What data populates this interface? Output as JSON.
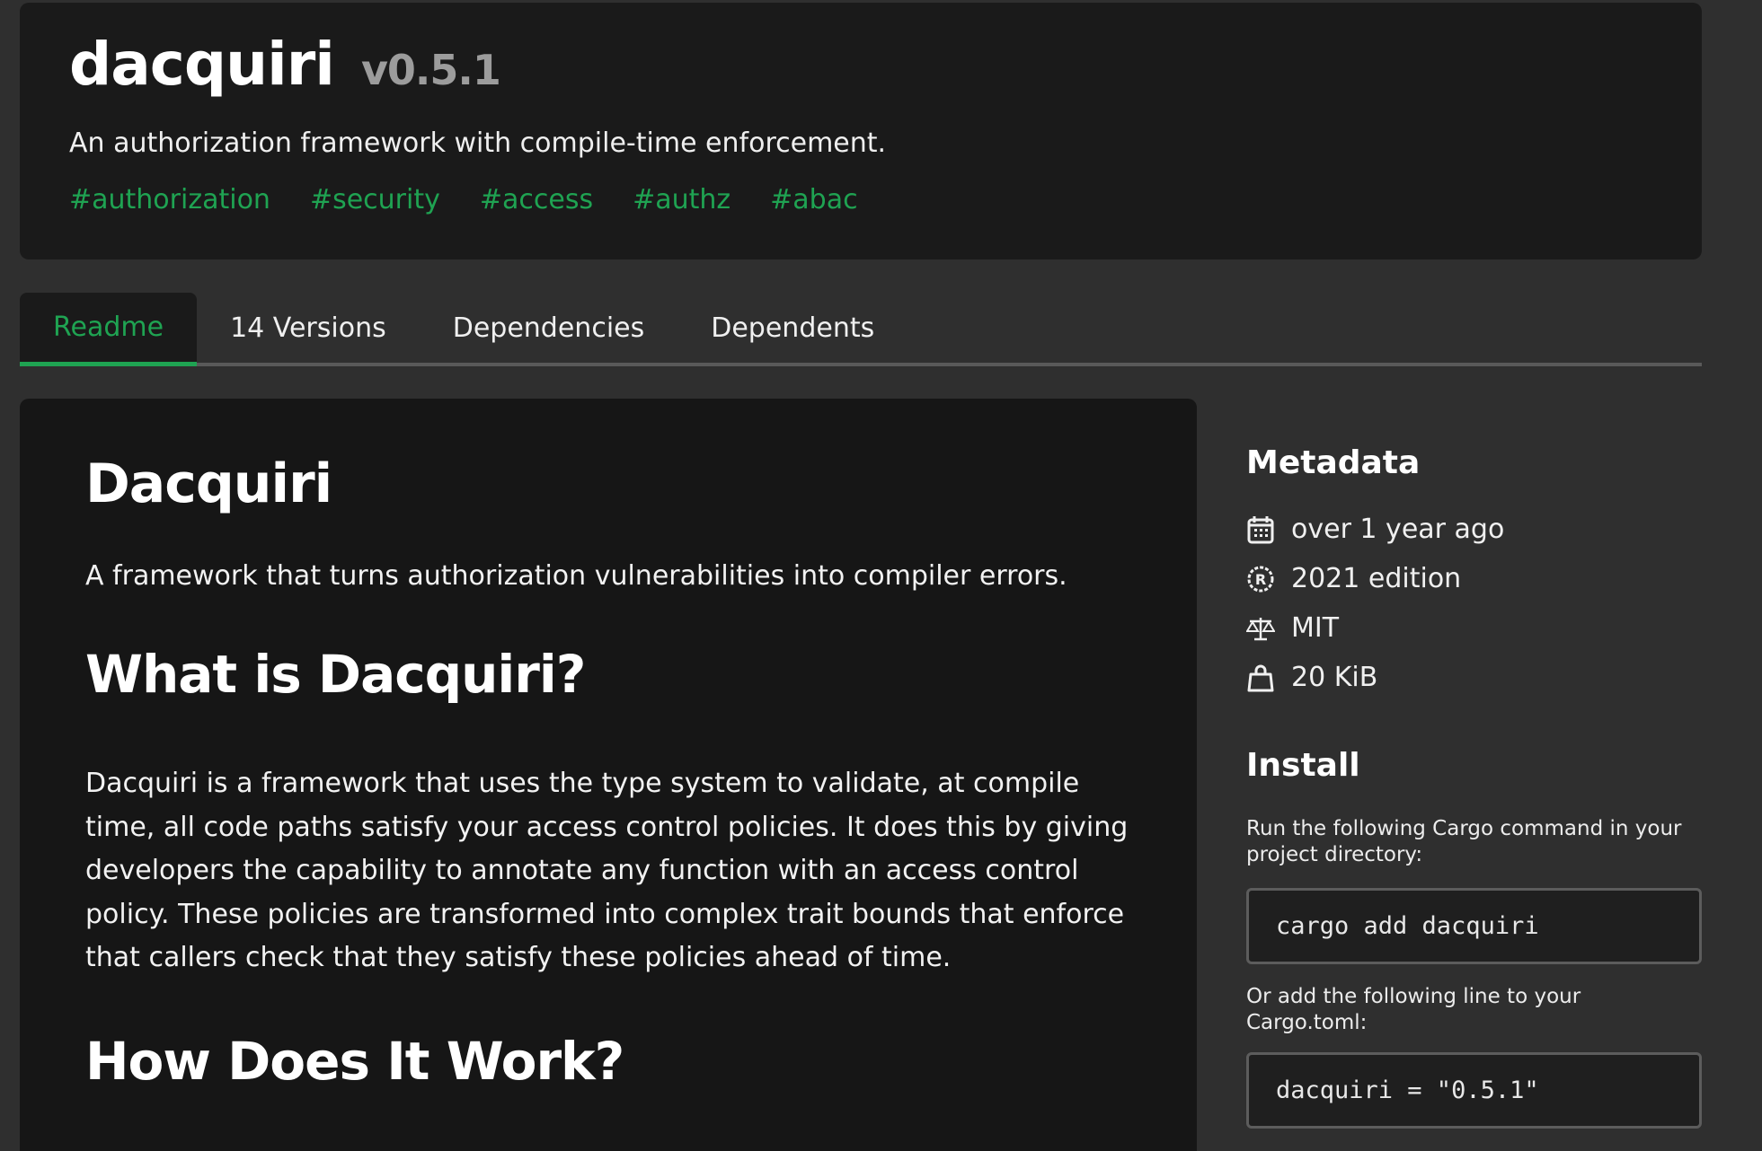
{
  "header": {
    "name": "dacquiri",
    "version": "v0.5.1",
    "description": "An authorization framework with compile-time enforcement.",
    "keywords": [
      "#authorization",
      "#security",
      "#access",
      "#authz",
      "#abac"
    ]
  },
  "tabs": [
    {
      "label": "Readme",
      "active": true
    },
    {
      "label": "14 Versions",
      "active": false
    },
    {
      "label": "Dependencies",
      "active": false
    },
    {
      "label": "Dependents",
      "active": false
    }
  ],
  "readme": {
    "title": "Dacquiri",
    "lede": "A framework that turns authorization vulnerabilities into compiler errors.",
    "section1_title": "What is Dacquiri?",
    "section1_body": "Dacquiri is a framework that uses the type system to validate, at compile time, all code paths satisfy your access control policies. It does this by giving developers the capability to annotate any function with an access control policy. These policies are transformed into complex trait bounds that enforce that callers check that they satisfy these policies ahead of time.",
    "section2_title": "How Does It Work?"
  },
  "sidebar": {
    "metadata_title": "Metadata",
    "metadata": [
      {
        "icon": "calendar-icon",
        "text": "over 1 year ago"
      },
      {
        "icon": "rust-edition-icon",
        "text": "2021 edition"
      },
      {
        "icon": "scale-license-icon",
        "text": "MIT"
      },
      {
        "icon": "bag-size-icon",
        "text": "20 KiB"
      }
    ],
    "install_title": "Install",
    "install_note1": "Run the following Cargo command in your project directory:",
    "install_cmd": "cargo add dacquiri",
    "install_note2": "Or add the following line to your Cargo.toml:",
    "install_toml": "dacquiri = \"0.5.1\""
  },
  "colors": {
    "accent": "#1fa352",
    "background": "#2f2f2f",
    "card": "#1a1a1a"
  }
}
